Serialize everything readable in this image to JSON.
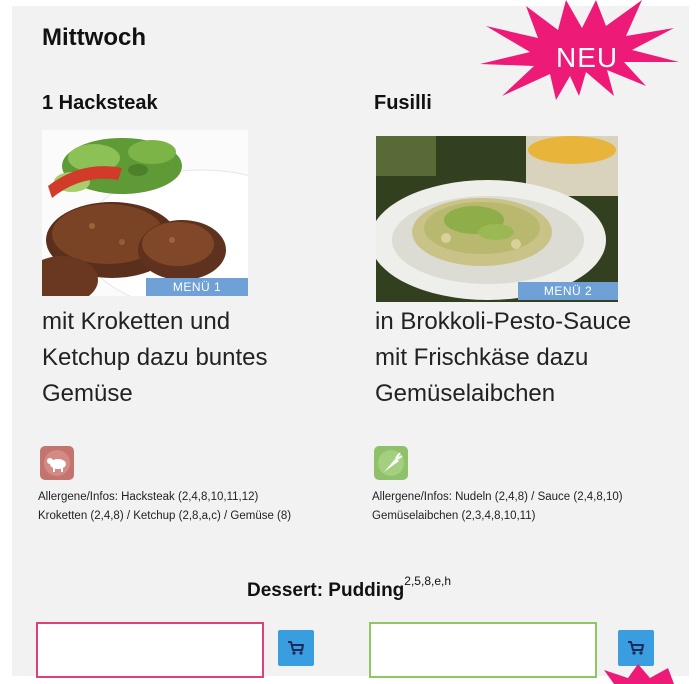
{
  "day": "Mittwoch",
  "badge": {
    "text": "NEU",
    "color": "#ee1a78"
  },
  "menus": [
    {
      "title": "1 Hacksteak",
      "tag": "MENÜ 1",
      "description_lines": [
        "mit Kroketten und",
        "Ketchup dazu buntes",
        "Gemüse"
      ],
      "diet_icon": "lamb-icon",
      "diet_color": "#c4746e",
      "allergen_lines": [
        "Allergene/Infos: Hacksteak (2,4,8,10,11,12)",
        "Kroketten (2,4,8) / Ketchup (2,8,a,c) / Gemüse (8)"
      ],
      "border_color": "#e0407a"
    },
    {
      "title": "Fusilli",
      "tag": "MENÜ 2",
      "description_lines": [
        "in Brokkoli-Pesto-Sauce",
        "mit Frischkäse dazu",
        "Gemüselaibchen"
      ],
      "diet_icon": "carrot-icon",
      "diet_color": "#8fc06a",
      "allergen_lines": [
        "Allergene/Infos: Nudeln (2,4,8) / Sauce (2,4,8,10)",
        "Gemüselaibchen (2,3,4,8,10,11)"
      ],
      "border_color": "#8fc860"
    }
  ],
  "dessert": {
    "label": "Dessert: Pudding",
    "allergens": "2,5,8,e,h"
  },
  "cart_color": "#3a9de0"
}
